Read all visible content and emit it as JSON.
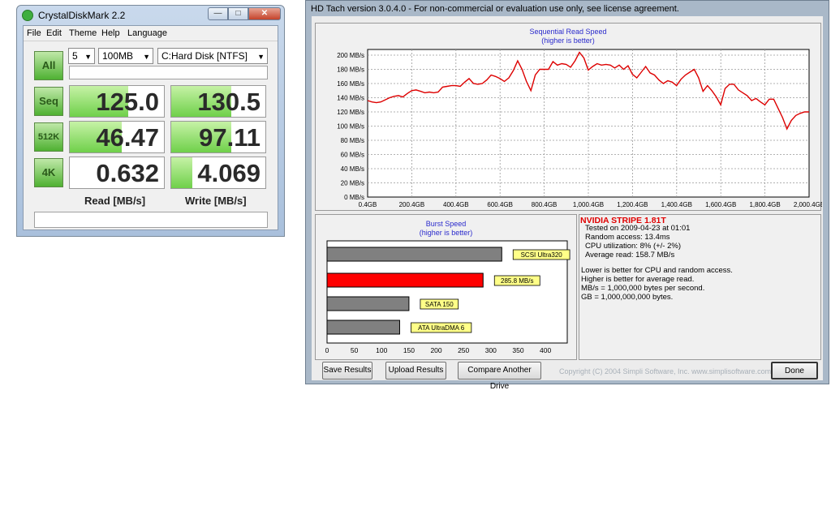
{
  "cdm": {
    "title": "CrystalDiskMark 2.2",
    "menu": [
      "File",
      "Edit",
      "Theme",
      "Help",
      "Language"
    ],
    "all_label": "All",
    "count": "5",
    "size": "100MB",
    "drive": "C:Hard Disk [NTFS]",
    "rows": [
      {
        "label": "Seq",
        "read": "125.0",
        "write": "130.5",
        "read_fill": 0.62,
        "write_fill": 0.64
      },
      {
        "label": "512K",
        "read": "46.47",
        "write": "97.11",
        "read_fill": 0.55,
        "write_fill": 0.64
      },
      {
        "label": "4K",
        "read": "0.632",
        "write": "4.069",
        "read_fill": 0.0,
        "write_fill": 0.22
      }
    ],
    "read_label": "Read [MB/s]",
    "write_label": "Write [MB/s]"
  },
  "hdtach": {
    "title": "HD Tach version 3.0.4.0  - For non-commercial or evaluation use only, see license agreement.",
    "seq_title": "Sequential Read Speed",
    "seq_subtitle": "(higher is better)",
    "burst_title": "Burst Speed",
    "burst_subtitle": "(higher is better)",
    "drive_name": "NVIDIA  STRIPE  1.81T",
    "info_lines": [
      "Tested on 2009-04-23 at 01:01",
      "Random access: 13.4ms",
      "CPU utilization: 8% (+/- 2%)",
      "Average read: 158.7 MB/s"
    ],
    "notes": [
      "Lower is better for CPU and random access.",
      "Higher is better for average read.",
      "MB/s = 1,000,000 bytes per second.",
      "GB = 1,000,000,000 bytes."
    ],
    "buttons": [
      "Save Results",
      "Upload Results",
      "Compare Another Drive",
      "Done"
    ],
    "copyright": "Copyright (C) 2004 Simpli Software, Inc. www.simplisoftware.com",
    "colors": {
      "line": "#dd0000",
      "bar_red": "#ff0000",
      "bar_gray": "#808080",
      "tag_bg": "#ffff88"
    }
  },
  "chart_data": [
    {
      "type": "line",
      "title": "Sequential Read Speed",
      "subtitle": "(higher is better)",
      "x_ticks": [
        "0.4GB",
        "200.4GB",
        "400.4GB",
        "600.4GB",
        "800.4GB",
        "1,000.4GB",
        "1,200.4GB",
        "1,400.4GB",
        "1,600.4GB",
        "1,800.4GB",
        "2,000.4GB"
      ],
      "y_ticks": [
        "0 MB/s",
        "20 MB/s",
        "40 MB/s",
        "60 MB/s",
        "80 MB/s",
        "100 MB/s",
        "120 MB/s",
        "140 MB/s",
        "160 MB/s",
        "180 MB/s",
        "200 MB/s"
      ],
      "xlim": [
        0.4,
        2000.4
      ],
      "ylim": [
        0,
        208
      ],
      "grid": true,
      "x": [
        0.4,
        20,
        40,
        60,
        80,
        100,
        120,
        140,
        160,
        180,
        200,
        220,
        240,
        260,
        280,
        300,
        320,
        340,
        360,
        380,
        400,
        420,
        440,
        460,
        480,
        500,
        520,
        540,
        560,
        580,
        600,
        620,
        640,
        660,
        680,
        700,
        720,
        740,
        760,
        780,
        800,
        820,
        840,
        860,
        880,
        900,
        920,
        940,
        960,
        980,
        1000,
        1020,
        1040,
        1060,
        1080,
        1100,
        1120,
        1140,
        1160,
        1180,
        1200,
        1220,
        1240,
        1260,
        1280,
        1300,
        1320,
        1340,
        1360,
        1380,
        1400,
        1420,
        1440,
        1460,
        1480,
        1500,
        1520,
        1540,
        1560,
        1580,
        1600,
        1620,
        1640,
        1660,
        1680,
        1700,
        1720,
        1740,
        1760,
        1780,
        1800,
        1820,
        1840,
        1860,
        1880,
        1900,
        1920,
        1940,
        1960,
        1980,
        2000.4
      ],
      "y": [
        136,
        134,
        133,
        134,
        137,
        140,
        142,
        143,
        141,
        146,
        150,
        151,
        149,
        147,
        148,
        147,
        148,
        155,
        156,
        157,
        157,
        156,
        162,
        167,
        160,
        159,
        160,
        165,
        172,
        170,
        167,
        163,
        168,
        178,
        192,
        180,
        163,
        150,
        172,
        180,
        180,
        180,
        191,
        186,
        188,
        187,
        183,
        192,
        204,
        196,
        179,
        184,
        188,
        186,
        187,
        186,
        182,
        186,
        180,
        185,
        173,
        168,
        176,
        184,
        175,
        172,
        165,
        160,
        164,
        162,
        157,
        166,
        172,
        176,
        180,
        168,
        149,
        157,
        150,
        141,
        130,
        153,
        159,
        159,
        151,
        147,
        143,
        136,
        139,
        134,
        130,
        138,
        138,
        125,
        112,
        96,
        108,
        115,
        118,
        120,
        120
      ]
    },
    {
      "type": "bar",
      "title": "Burst Speed",
      "subtitle": "(higher is better)",
      "categories": [
        "SCSI Ultra320",
        "285.8 MB/s",
        "SATA 150",
        "ATA UltraDMA 6"
      ],
      "values": [
        320,
        285.8,
        150,
        133
      ],
      "x_ticks": [
        "0",
        "50",
        "100",
        "150",
        "200",
        "250",
        "300",
        "350",
        "400"
      ],
      "xlim": [
        0,
        440
      ]
    }
  ]
}
